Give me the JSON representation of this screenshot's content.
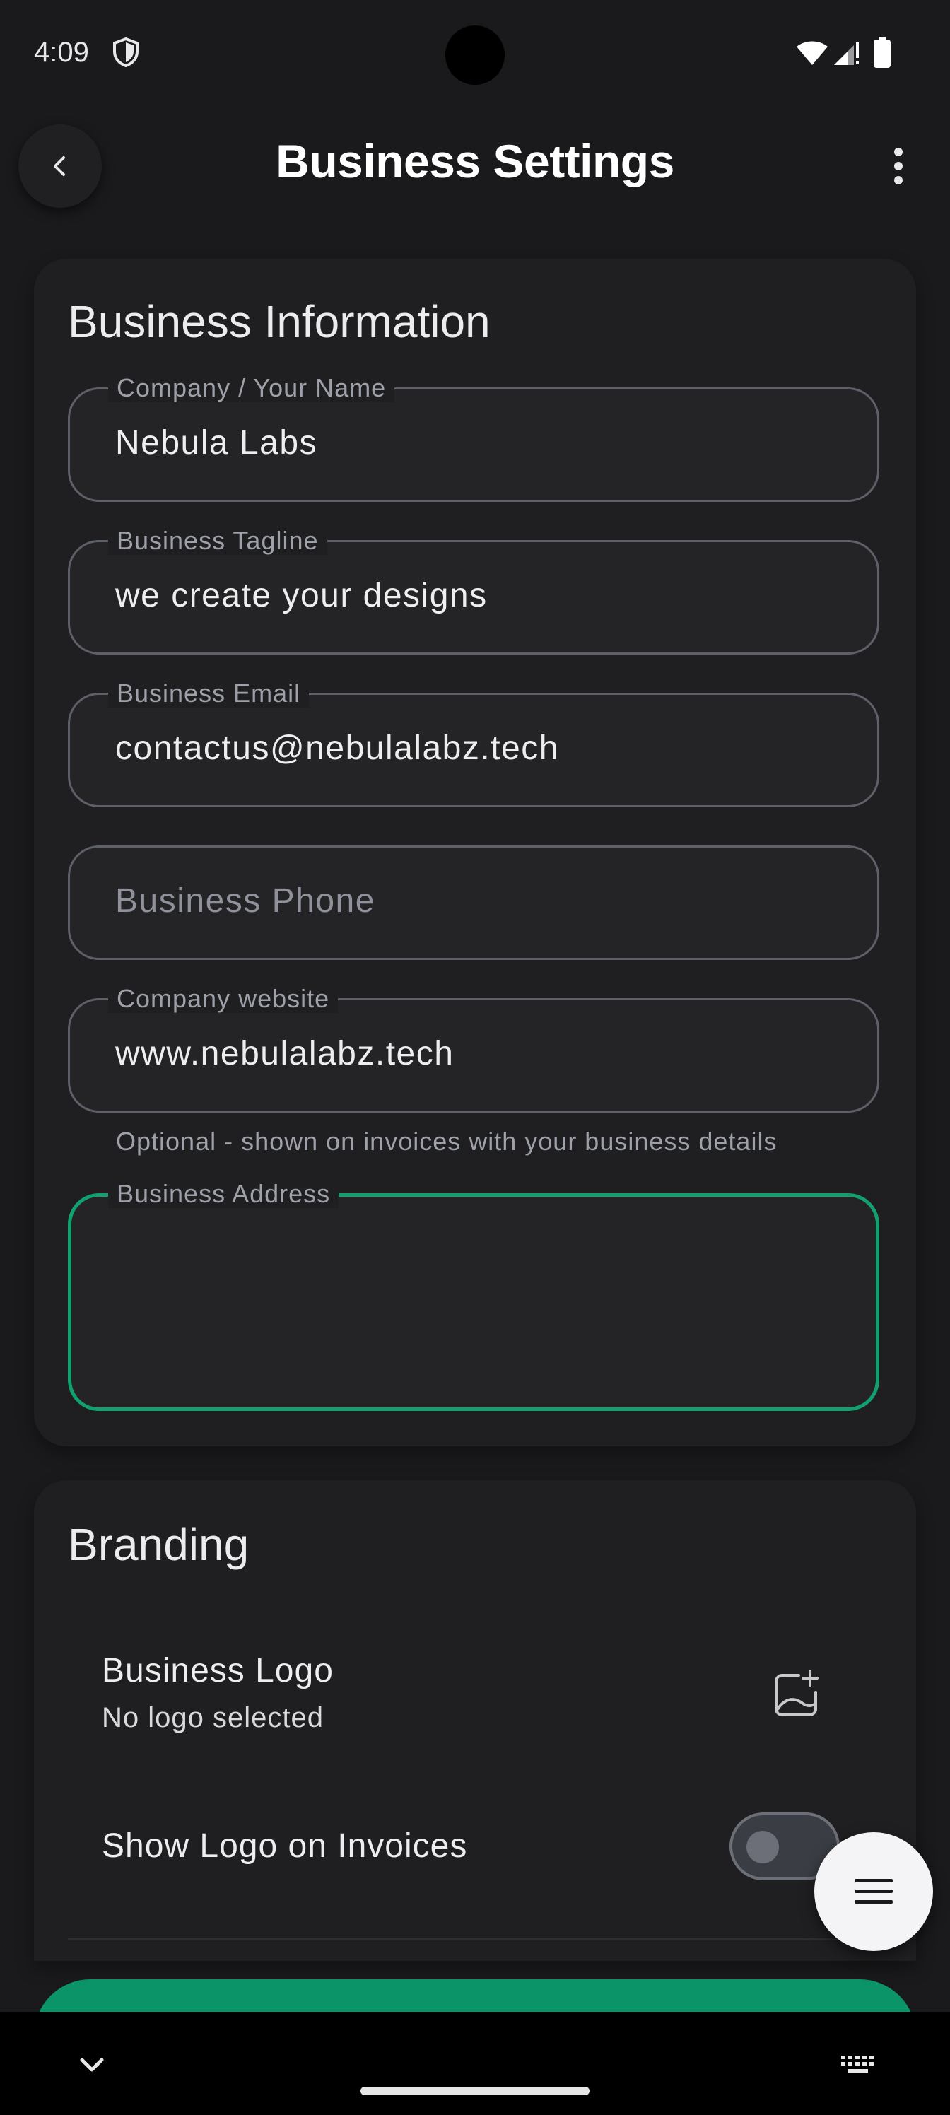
{
  "status_bar": {
    "time": "4:09"
  },
  "app_bar": {
    "title": "Business Settings"
  },
  "business_info": {
    "title": "Business Information",
    "fields": [
      {
        "label": "Company / Your Name",
        "value": "Nebula Labs"
      },
      {
        "label": "Business Tagline",
        "value": "we create your designs"
      },
      {
        "label": "Business Email",
        "value": "contactus@nebulalabz.tech"
      },
      {
        "label": "",
        "placeholder": "Business Phone",
        "value": ""
      },
      {
        "label": "Company website",
        "value": "www.nebulalabz.tech",
        "helper": "Optional - shown on invoices with your business details"
      },
      {
        "label": "Business Address",
        "value": ""
      }
    ]
  },
  "branding": {
    "title": "Branding",
    "logo_title": "Business Logo",
    "logo_subtitle": "No logo selected",
    "show_logo_label": "Show Logo on Invoices",
    "show_logo_enabled": false
  },
  "colors": {
    "accent": "#0b9468",
    "focus": "#12a06f",
    "background": "#1a1a1c",
    "card": "#1f1f21"
  },
  "icons": {
    "back": "chevron-left-icon",
    "more": "more-vertical-icon",
    "logo": "add-photo-icon",
    "fab": "menu-icon",
    "nav": "chevron-down-icon",
    "keyboard": "keyboard-icon"
  }
}
